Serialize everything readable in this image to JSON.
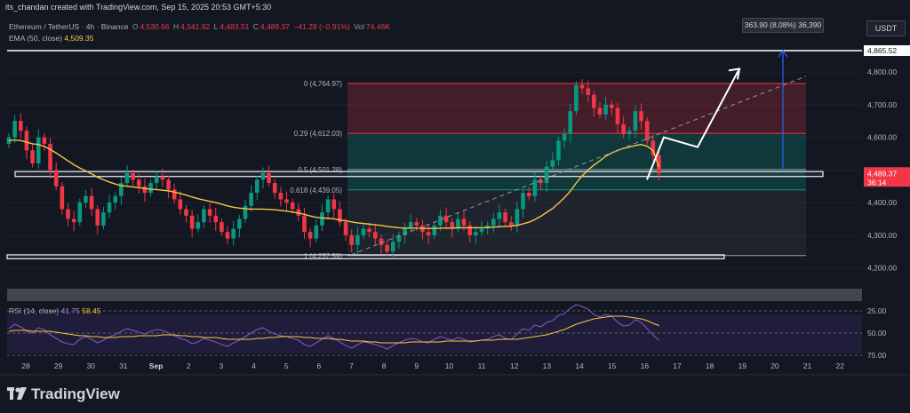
{
  "header": {
    "attribution": "its_chandan created with TradingView.com, Sep 15, 2025 20:53 GMT+5:30"
  },
  "legend": {
    "symbol": "Ethereum / TetherUS · 4h · Binance",
    "open_label": "O",
    "open": "4,530.66",
    "high_label": "H",
    "high": "4,541.92",
    "low_label": "L",
    "low": "4,483.51",
    "close_label": "C",
    "close": "4,489.37",
    "change": "−41.28 (−0.91%)",
    "vol_label": "Vol",
    "vol": "74.46K",
    "ema_label": "EMA (50, close)",
    "ema_value": "4,509.35"
  },
  "currency_badge": "USDT",
  "measure_label": "363.90 (8.08%) 36,390",
  "price_labels": {
    "last": "4,489.37",
    "countdown": "36:14",
    "target": "4,865.52"
  },
  "rsi": {
    "label": "RSI (14, close)",
    "value": "41.75",
    "ma_value": "58.45",
    "levels": [
      "75.00",
      "50.00",
      "25.00"
    ]
  },
  "footer": {
    "brand": "TradingView"
  },
  "chart_data": [
    {
      "type": "candlestick",
      "title": "Ethereum / TetherUS · 4h · Binance",
      "y_ticks": [
        4200,
        4300,
        4400,
        4500,
        4600,
        4700,
        4800
      ],
      "y_tick_labels": [
        "4,200.00",
        "4,300.00",
        "4,400.00",
        "4,500.00",
        "4,600.00",
        "4,700.00",
        "4,800.00"
      ],
      "ylim": [
        4150,
        4890
      ],
      "x_ticks": [
        "28",
        "29",
        "30",
        "31",
        "Sep",
        "2",
        "3",
        "4",
        "5",
        "6",
        "7",
        "8",
        "9",
        "10",
        "11",
        "12",
        "13",
        "14",
        "15",
        "16",
        "17",
        "18",
        "19",
        "20",
        "21",
        "22"
      ],
      "series": [
        {
          "name": "ETHUSDT",
          "close": [
            4600,
            4650,
            4620,
            4560,
            4520,
            4600,
            4580,
            4500,
            4450,
            4380,
            4350,
            4340,
            4400,
            4420,
            4380,
            4330,
            4370,
            4400,
            4420,
            4460,
            4490,
            4470,
            4450,
            4430,
            4460,
            4480,
            4470,
            4440,
            4410,
            4380,
            4360,
            4320,
            4340,
            4380,
            4360,
            4340,
            4310,
            4290,
            4320,
            4350,
            4390,
            4430,
            4470,
            4490,
            4460,
            4430,
            4410,
            4400,
            4380,
            4360,
            4310,
            4290,
            4330,
            4370,
            4410,
            4380,
            4340,
            4300,
            4270,
            4300,
            4320,
            4310,
            4290,
            4270,
            4250,
            4280,
            4300,
            4320,
            4340,
            4330,
            4310,
            4300,
            4330,
            4360,
            4340,
            4320,
            4350,
            4330,
            4300,
            4310,
            4320,
            4330,
            4350,
            4370,
            4340,
            4330,
            4380,
            4430,
            4420,
            4470,
            4460,
            4510,
            4530,
            4590,
            4610,
            4680,
            4760,
            4750,
            4730,
            4690,
            4670,
            4700,
            4690,
            4640,
            4610,
            4620,
            4680,
            4650,
            4590,
            4545,
            4489.37
          ],
          "ema_50": [
            4590,
            4592,
            4590,
            4585,
            4580,
            4578,
            4572,
            4563,
            4552,
            4540,
            4528,
            4516,
            4506,
            4497,
            4488,
            4478,
            4470,
            4463,
            4457,
            4452,
            4450,
            4448,
            4446,
            4443,
            4441,
            4440,
            4438,
            4436,
            4432,
            4428,
            4423,
            4417,
            4412,
            4408,
            4404,
            4400,
            4395,
            4390,
            4386,
            4383,
            4381,
            4380,
            4380,
            4380,
            4379,
            4378,
            4376,
            4374,
            4371,
            4368,
            4364,
            4359,
            4355,
            4353,
            4352,
            4350,
            4347,
            4344,
            4341,
            4338,
            4336,
            4334,
            4332,
            4330,
            4327,
            4325,
            4323,
            4322,
            4322,
            4322,
            4321,
            4321,
            4321,
            4322,
            4322,
            4322,
            4323,
            4323,
            4323,
            4323,
            4323,
            4324,
            4325,
            4326,
            4327,
            4328,
            4330,
            4335,
            4340,
            4348,
            4358,
            4370,
            4382,
            4398,
            4415,
            4435,
            4460,
            4482,
            4500,
            4515,
            4528,
            4542,
            4552,
            4560,
            4566,
            4570,
            4575,
            4578,
            4573,
            4560,
            4509.35
          ]
        }
      ],
      "fib_levels": [
        {
          "label": "0 (4,764.97)",
          "ratio": 0,
          "price": 4764.97,
          "color": "#f23645"
        },
        {
          "label": "0.29 (4,612.03)",
          "ratio": 0.29,
          "price": 4612.03,
          "color": "#f23645"
        },
        {
          "label": "0.5 (4,501.28)",
          "ratio": 0.5,
          "price": 4501.28,
          "color": "#9e9e9e"
        },
        {
          "label": "0.618 (4,439.05)",
          "ratio": 0.618,
          "price": 4439.05,
          "color": "#089981"
        },
        {
          "label": "1 (4,237.59)",
          "ratio": 1,
          "price": 4237.59,
          "color": "#9e9e9e"
        }
      ],
      "zones": [
        {
          "name": "resistance-top",
          "price": 4865.52
        },
        {
          "name": "support-mid",
          "price_low": 4480,
          "price_high": 4495
        },
        {
          "name": "support-low",
          "price_low": 4228,
          "price_high": 4240
        }
      ],
      "projection_path": [
        4470,
        4600,
        4570,
        4810
      ],
      "colors": {
        "up": "#089981",
        "down": "#f23645",
        "ema": "#f7c744",
        "background": "#131722"
      }
    },
    {
      "type": "line",
      "title": "RSI (14, close)",
      "ylim": [
        15,
        85
      ],
      "y_ticks": [
        25,
        50,
        75
      ],
      "series": [
        {
          "name": "RSI",
          "values": [
            55,
            60,
            57,
            52,
            50,
            56,
            54,
            48,
            44,
            40,
            38,
            37,
            43,
            46,
            43,
            39,
            42,
            46,
            48,
            52,
            55,
            53,
            51,
            49,
            52,
            54,
            53,
            50,
            47,
            44,
            42,
            38,
            40,
            44,
            42,
            40,
            37,
            35,
            39,
            42,
            46,
            50,
            54,
            56,
            52,
            49,
            47,
            46,
            44,
            42,
            37,
            35,
            39,
            43,
            47,
            44,
            40,
            36,
            33,
            37,
            40,
            39,
            37,
            35,
            32,
            36,
            39,
            42,
            44,
            43,
            40,
            39,
            43,
            46,
            44,
            42,
            45,
            43,
            40,
            41,
            42,
            43,
            46,
            48,
            44,
            43,
            49,
            55,
            53,
            59,
            57,
            62,
            64,
            70,
            72,
            78,
            82,
            80,
            77,
            71,
            68,
            71,
            69,
            62,
            58,
            59,
            65,
            62,
            55,
            48,
            41.75
          ]
        },
        {
          "name": "RSI-based MA",
          "values": [
            52,
            53,
            53,
            53,
            52,
            52,
            52,
            52,
            51,
            50,
            49,
            48,
            47,
            47,
            46,
            46,
            45,
            45,
            45,
            46,
            46,
            46,
            47,
            47,
            47,
            47,
            48,
            48,
            48,
            47,
            47,
            46,
            46,
            45,
            45,
            45,
            44,
            43,
            43,
            43,
            43,
            43,
            44,
            44,
            45,
            45,
            46,
            46,
            46,
            46,
            45,
            45,
            44,
            44,
            44,
            43,
            43,
            42,
            41,
            41,
            41,
            40,
            40,
            39,
            39,
            39,
            39,
            39,
            40,
            40,
            40,
            40,
            40,
            40,
            41,
            41,
            41,
            41,
            41,
            41,
            42,
            42,
            42,
            43,
            43,
            43,
            43,
            44,
            45,
            46,
            47,
            48,
            50,
            52,
            54,
            57,
            60,
            62,
            64,
            66,
            67,
            68,
            69,
            69,
            69,
            68,
            67,
            66,
            64,
            61,
            58.45
          ]
        }
      ]
    }
  ]
}
